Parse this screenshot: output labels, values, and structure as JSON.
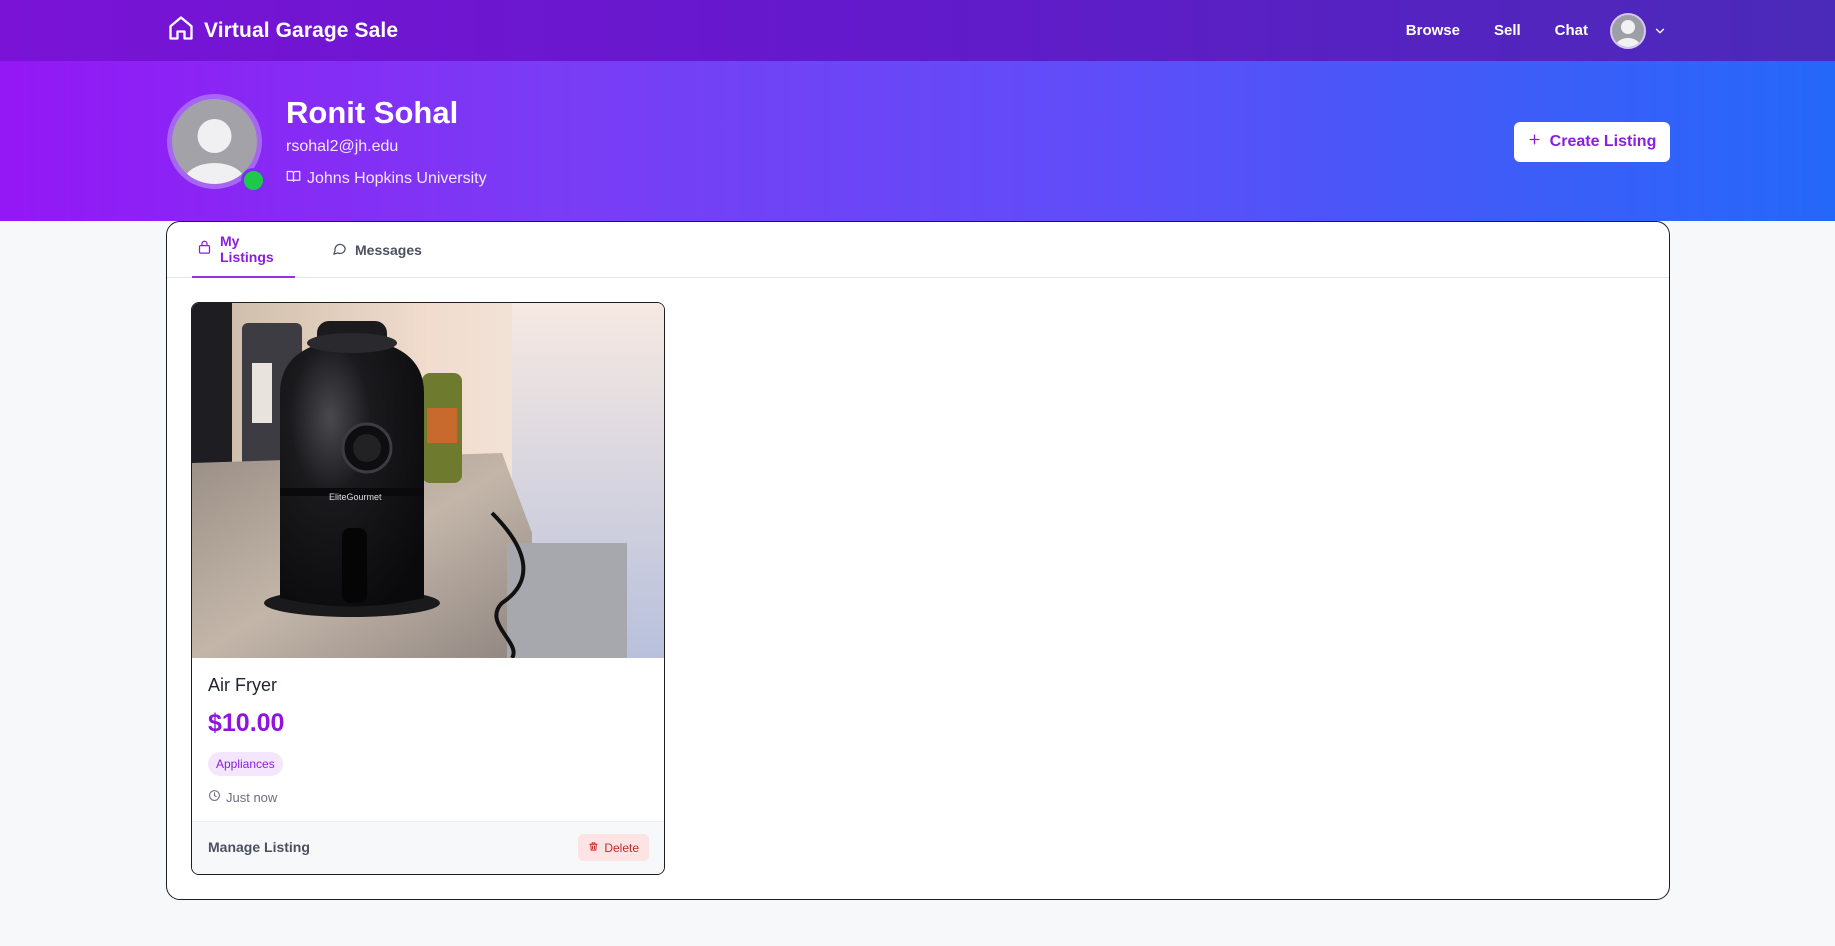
{
  "nav": {
    "brand": "Virtual Garage Sale",
    "links": [
      "Browse",
      "Sell",
      "Chat"
    ]
  },
  "profile": {
    "name": "Ronit Sohal",
    "email": "rsohal2@jh.edu",
    "school": "Johns Hopkins University",
    "status": "online"
  },
  "actions": {
    "create_listing": "Create Listing"
  },
  "tabs": [
    {
      "label": "My Listings",
      "active": true
    },
    {
      "label": "Messages",
      "active": false
    }
  ],
  "listings": [
    {
      "title": "Air Fryer",
      "price": "$10.00",
      "category": "Appliances",
      "posted": "Just now",
      "manage_label": "Manage Listing",
      "delete_label": "Delete",
      "image_text": "EliteGourmet"
    }
  ],
  "colors": {
    "accent": "#8a1ee0",
    "online": "#1ec94a",
    "delete": "#c62828"
  }
}
